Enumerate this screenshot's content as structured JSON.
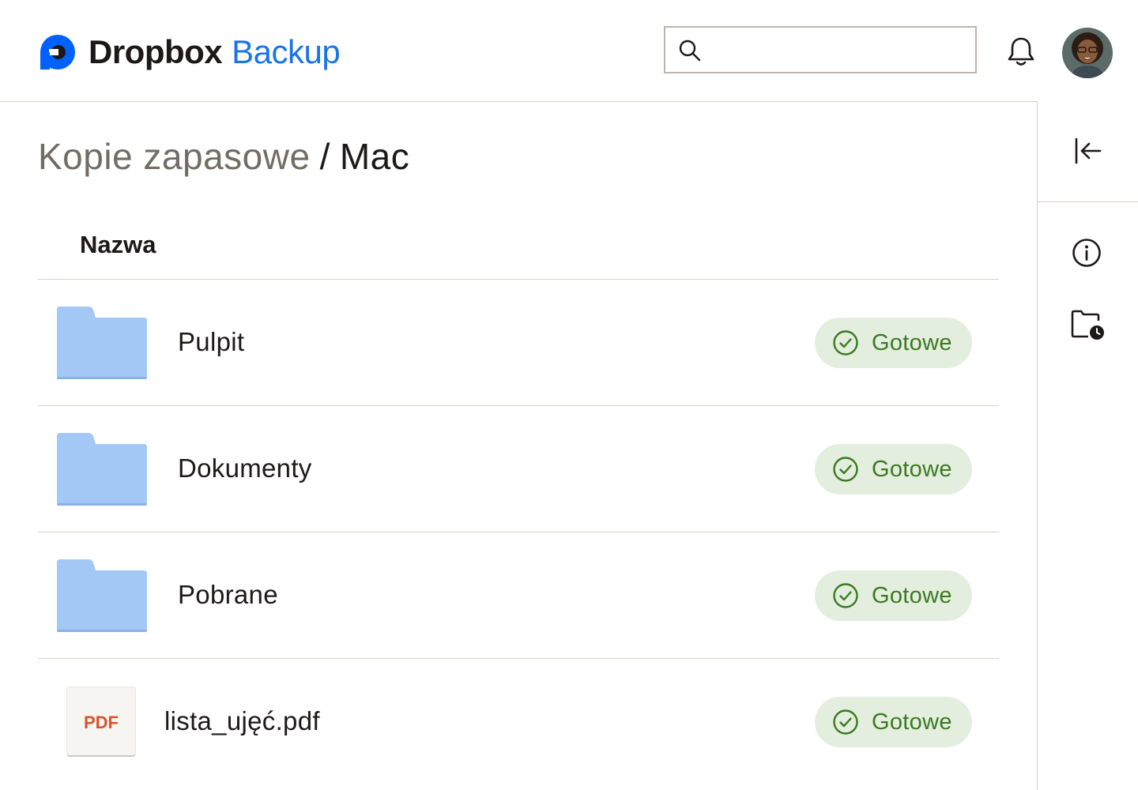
{
  "app": {
    "brand": "Dropbox",
    "product": "Backup",
    "brand_color": "#0061fe",
    "product_color": "#1a74e8"
  },
  "header": {
    "search": {
      "placeholder": "",
      "value": "",
      "icon": "search-icon"
    },
    "notifications_icon": "bell-icon",
    "avatar": "user-avatar"
  },
  "breadcrumb": {
    "parent": "Kopie zapasowe",
    "separator": "/",
    "current": "Mac"
  },
  "table": {
    "column_name": "Nazwa",
    "rows": [
      {
        "type": "folder",
        "name": "Pulpit",
        "status": "Gotowe"
      },
      {
        "type": "folder",
        "name": "Dokumenty",
        "status": "Gotowe"
      },
      {
        "type": "folder",
        "name": "Pobrane",
        "status": "Gotowe"
      },
      {
        "type": "file",
        "name": "lista_ujęć.pdf",
        "status": "Gotowe",
        "thumb_label": "PDF"
      }
    ]
  },
  "right_rail": {
    "collapse_icon": "collapse-panel-icon",
    "info_icon": "info-icon",
    "backup_history_icon": "folder-clock-icon"
  },
  "colors": {
    "status_bg": "#e4eedf",
    "status_text": "#3b7a20",
    "folder": "#a4c8f5",
    "pdf_label": "#d9532b"
  }
}
